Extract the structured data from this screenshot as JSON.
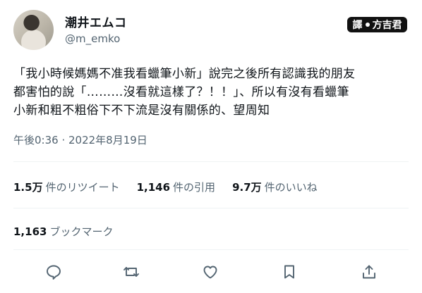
{
  "profile": {
    "display_name": "潮井エムコ",
    "handle": "@m_emko"
  },
  "watermark": {
    "left": "譯",
    "right": "方吉君"
  },
  "tweet": {
    "lines": [
      "「我小時候媽媽不准我看蠟筆小新」說完之後所有認識我的朋友",
      "都害怕的說「………沒看就這樣了？！！」、所以有沒有看蠟筆",
      "小新和粗不粗俗下不下流是沒有關係的、望周知"
    ],
    "timestamp": "午後0:36 · 2022年8月19日"
  },
  "stats": {
    "retweets": {
      "value": "1.5万",
      "label": "件のリツイート"
    },
    "quotes": {
      "value": "1,146",
      "label": "件の引用"
    },
    "likes": {
      "value": "9.7万",
      "label": "件のいいね"
    },
    "bookmarks": {
      "value": "1,163",
      "label": "ブックマーク"
    }
  },
  "actions": {
    "icons": [
      "reply-icon",
      "retweet-icon",
      "like-icon",
      "bookmark-icon",
      "share-icon"
    ]
  },
  "colors": {
    "text": "#0f1419",
    "secondary": "#536471",
    "divider": "#eff3f4"
  }
}
